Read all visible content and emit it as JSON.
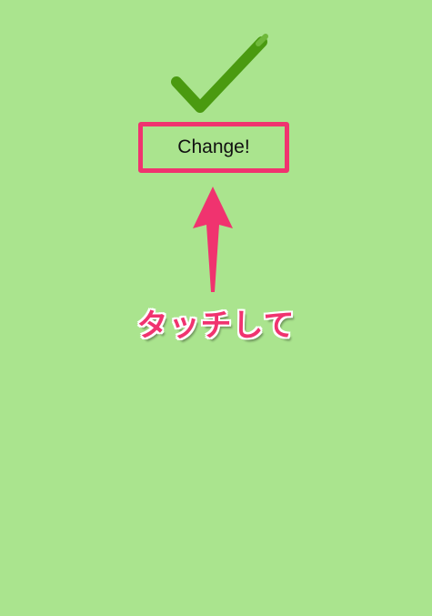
{
  "main": {
    "button_label": "Change!",
    "instruction_text": "タッチして"
  },
  "icons": {
    "checkmark": "checkmark-icon",
    "arrow": "arrow-up-icon"
  },
  "colors": {
    "background": "#aae48e",
    "checkmark": "#4a9a10",
    "highlight": "#f0336f",
    "button_text": "#111111"
  }
}
